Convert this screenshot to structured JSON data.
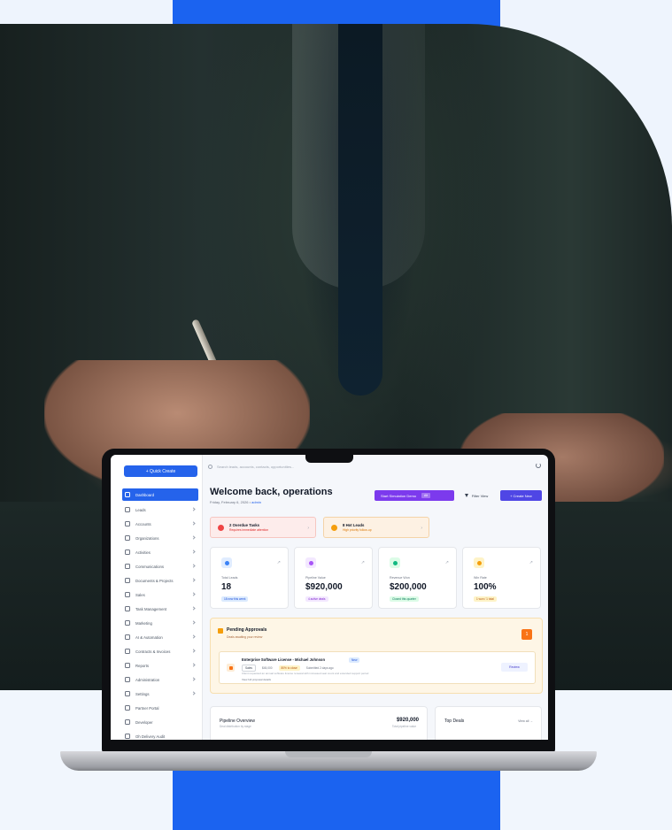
{
  "app": {
    "quick_create": "+ Quick Create",
    "search_placeholder": "Search leads, accounts, contacts, opportunities..."
  },
  "sidebar": {
    "items": [
      {
        "label": "Dashboard",
        "active": true
      },
      {
        "label": "Leads"
      },
      {
        "label": "Accounts"
      },
      {
        "label": "Organizations"
      },
      {
        "label": "Activities"
      },
      {
        "label": "Communications"
      },
      {
        "label": "Documents & Projects"
      },
      {
        "label": "Sales"
      },
      {
        "label": "Task Management"
      },
      {
        "label": "Marketing"
      },
      {
        "label": "AI & Automation"
      },
      {
        "label": "Contracts & Invoices"
      },
      {
        "label": "Reports"
      },
      {
        "label": "Administration"
      },
      {
        "label": "Settings"
      },
      {
        "label": "Partner Portal"
      },
      {
        "label": "Developer"
      },
      {
        "label": "Oh Delivery Audit"
      }
    ]
  },
  "header": {
    "title": "Welcome back, operations",
    "date": "Friday, February 6, 2026",
    "role": "admin",
    "simulate_button": "Start Simulation Demo",
    "simulate_tag": "Alt",
    "filter_button": "Filter View",
    "create_button": "+ Create New"
  },
  "alerts": [
    {
      "title": "2 Overdue Tasks",
      "subtitle": "Requires immediate attention"
    },
    {
      "title": "8 Hot Leads",
      "subtitle": "High priority follow-up"
    }
  ],
  "stats": [
    {
      "label": "Total Leads",
      "value": "18",
      "note": "18 new this week",
      "color": "#3b82f6",
      "bg": "#e0ecff",
      "note_bg": "#dbeafe",
      "note_color": "#1d4ed8"
    },
    {
      "label": "Pipeline Value",
      "value": "$920,000",
      "note": "4 active deals",
      "color": "#a855f7",
      "bg": "#f3e8ff",
      "note_bg": "#f3e8ff",
      "note_color": "#7e22ce"
    },
    {
      "label": "Revenue Won",
      "value": "$200,000",
      "note": "Closed this quarter",
      "color": "#10b981",
      "bg": "#dcfce7",
      "note_bg": "#dcfce7",
      "note_color": "#047857"
    },
    {
      "label": "Win Rate",
      "value": "100%",
      "note": "1 won / 1 total",
      "color": "#f59e0b",
      "bg": "#fef3c7",
      "note_bg": "#fef3c7",
      "note_color": "#b45309"
    }
  ],
  "approvals": {
    "title": "Pending Approvals",
    "subtitle": "Deals awaiting your review",
    "count": "1",
    "item": {
      "title": "Enterprise Software License - Michael Johnson",
      "stage": "New",
      "type": "Sales",
      "amount": "$45,000",
      "probability": "80% to close",
      "requested": "Submitted 2 days ago",
      "description": "Client requested an annual software license renewal with increased seat count and extended support period",
      "view_link": "View full proposal details",
      "review_button": "Review"
    }
  },
  "pipeline": {
    "title": "Pipeline Overview",
    "subtitle": "Deal distribution by stage",
    "value": "$920,000",
    "value_sub": "Total pipeline value"
  },
  "top_deals": {
    "title": "Top Deals",
    "view_all": "View all →"
  }
}
